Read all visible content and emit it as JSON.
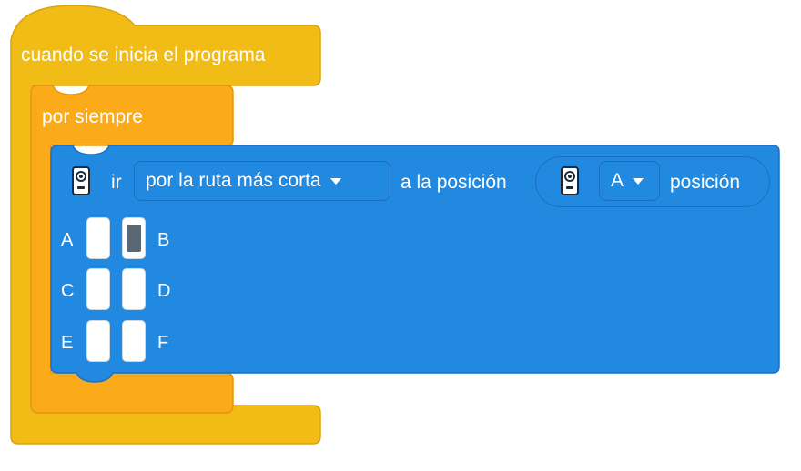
{
  "event_block": {
    "label": "cuando se inicia el programa",
    "color": "#f2bc16"
  },
  "loop_block": {
    "label": "por siempre",
    "color": "#fbaa19"
  },
  "motor_block": {
    "color": "#2289e0",
    "icon": "motor-hub-icon",
    "verb": "ir",
    "direction_dropdown": {
      "selected": "por la ruta más corta"
    },
    "mid_text": "a la posición",
    "position_reporter": {
      "icon": "motor-hub-icon",
      "port_dropdown": {
        "selected": "A"
      },
      "label": "posición"
    },
    "ports": [
      {
        "label": "A",
        "selected": false
      },
      {
        "label": "B",
        "selected": true
      },
      {
        "label": "C",
        "selected": false
      },
      {
        "label": "D",
        "selected": false
      },
      {
        "label": "E",
        "selected": false
      },
      {
        "label": "F",
        "selected": false
      }
    ]
  }
}
